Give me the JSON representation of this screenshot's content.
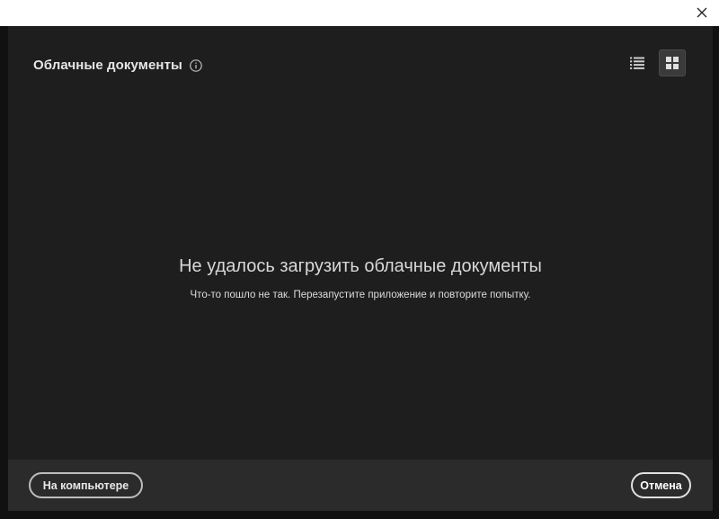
{
  "window": {
    "close_icon": "close-icon"
  },
  "header": {
    "title": "Облачные документы",
    "info_icon": "info-icon",
    "list_view_icon": "list-view-icon",
    "grid_view_icon": "grid-view-icon",
    "active_view": "grid"
  },
  "empty_state": {
    "title": "Не удалось загрузить облачные документы",
    "message": "Что-то пошло не так. Перезапустите приложение и повторите попытку."
  },
  "footer": {
    "local_button": "На компьютере",
    "cancel_button": "Отмена"
  },
  "colors": {
    "dialog_bg": "#1e1e1e",
    "footer_bg": "#2b2b2b",
    "titlebar_bg": "#ffffff",
    "text": "#e6e6e6"
  }
}
